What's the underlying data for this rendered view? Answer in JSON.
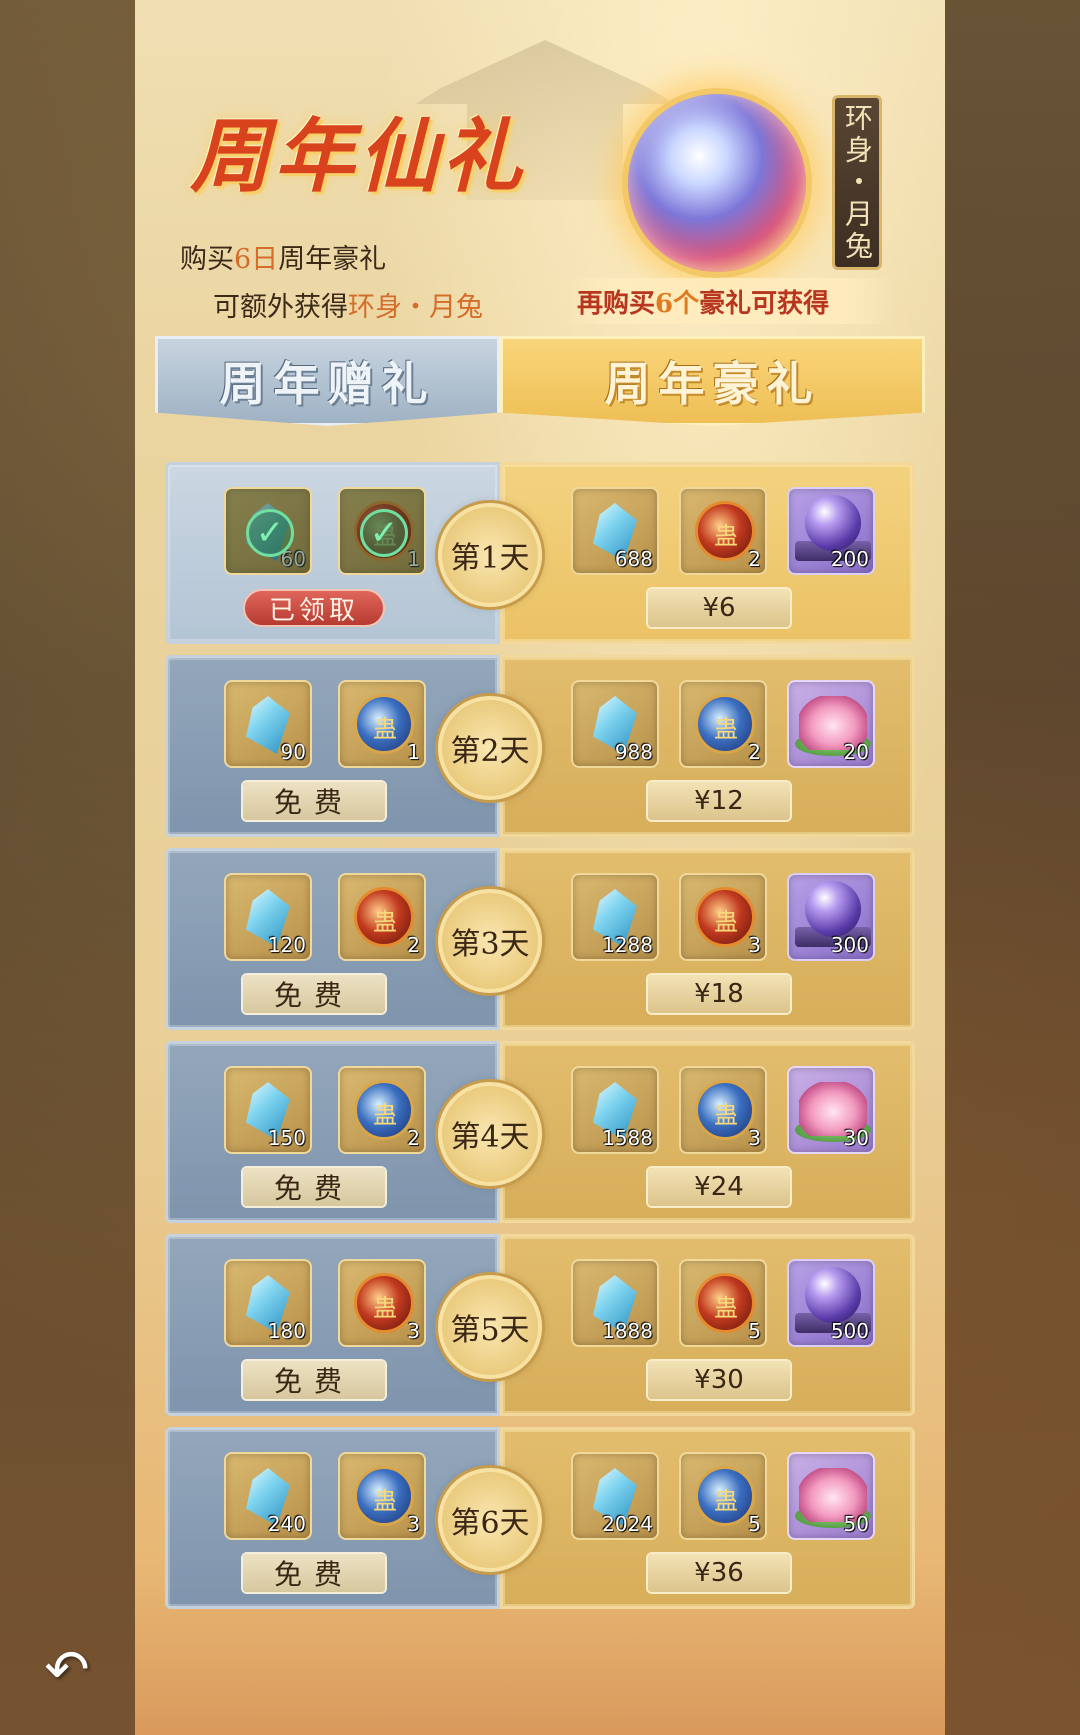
{
  "header": {
    "title": "周年仙礼",
    "line1_prefix": "购买",
    "line1_highlight": "6日",
    "line1_suffix": "周年豪礼",
    "line2_prefix": "可额外获得",
    "line2_highlight": "环身・月兔",
    "reward_name": "环身・月兔",
    "reward_caption_prefix": "再购买",
    "reward_caption_num": "6个",
    "reward_caption_suffix": "豪礼可获得"
  },
  "tabs": {
    "free": "周年赠礼",
    "premium": "周年豪礼"
  },
  "days": [
    {
      "label": "第1天",
      "free_items": [
        {
          "icon": "jade-icon",
          "qty": "60",
          "claimed": true
        },
        {
          "icon": "red-gu-orb-icon",
          "qty": "1",
          "claimed": true
        }
      ],
      "free_button": "已领取",
      "free_claimed": true,
      "premium_items": [
        {
          "icon": "jade-icon",
          "qty": "688"
        },
        {
          "icon": "red-gu-orb-icon",
          "qty": "2"
        },
        {
          "icon": "crystal-ball-icon",
          "qty": "200"
        }
      ],
      "price": "¥6"
    },
    {
      "label": "第2天",
      "free_items": [
        {
          "icon": "jade-icon",
          "qty": "90"
        },
        {
          "icon": "blue-gu-orb-icon",
          "qty": "1"
        }
      ],
      "free_button": "免费",
      "free_claimed": false,
      "premium_items": [
        {
          "icon": "jade-icon",
          "qty": "988"
        },
        {
          "icon": "blue-gu-orb-icon",
          "qty": "2"
        },
        {
          "icon": "lotus-icon",
          "qty": "20"
        }
      ],
      "price": "¥12"
    },
    {
      "label": "第3天",
      "free_items": [
        {
          "icon": "jade-icon",
          "qty": "120"
        },
        {
          "icon": "red-gu-orb-icon",
          "qty": "2"
        }
      ],
      "free_button": "免费",
      "free_claimed": false,
      "premium_items": [
        {
          "icon": "jade-icon",
          "qty": "1288"
        },
        {
          "icon": "red-gu-orb-icon",
          "qty": "3"
        },
        {
          "icon": "crystal-ball-icon",
          "qty": "300"
        }
      ],
      "price": "¥18"
    },
    {
      "label": "第4天",
      "free_items": [
        {
          "icon": "jade-icon",
          "qty": "150"
        },
        {
          "icon": "blue-gu-orb-icon",
          "qty": "2"
        }
      ],
      "free_button": "免费",
      "free_claimed": false,
      "premium_items": [
        {
          "icon": "jade-icon",
          "qty": "1588"
        },
        {
          "icon": "blue-gu-orb-icon",
          "qty": "3"
        },
        {
          "icon": "lotus-icon",
          "qty": "30"
        }
      ],
      "price": "¥24"
    },
    {
      "label": "第5天",
      "free_items": [
        {
          "icon": "jade-icon",
          "qty": "180"
        },
        {
          "icon": "red-gu-orb-icon",
          "qty": "3"
        }
      ],
      "free_button": "免费",
      "free_claimed": false,
      "premium_items": [
        {
          "icon": "jade-icon",
          "qty": "1888"
        },
        {
          "icon": "red-gu-orb-icon",
          "qty": "5"
        },
        {
          "icon": "crystal-ball-icon",
          "qty": "500"
        }
      ],
      "price": "¥30"
    },
    {
      "label": "第6天",
      "free_items": [
        {
          "icon": "jade-icon",
          "qty": "240"
        },
        {
          "icon": "blue-gu-orb-icon",
          "qty": "3"
        }
      ],
      "free_button": "免费",
      "free_claimed": false,
      "premium_items": [
        {
          "icon": "jade-icon",
          "qty": "2024"
        },
        {
          "icon": "blue-gu-orb-icon",
          "qty": "5"
        },
        {
          "icon": "lotus-icon",
          "qty": "50"
        }
      ],
      "price": "¥36"
    }
  ],
  "footer": {
    "back_icon": "back-arrow-icon",
    "back_glyph": "↶"
  }
}
